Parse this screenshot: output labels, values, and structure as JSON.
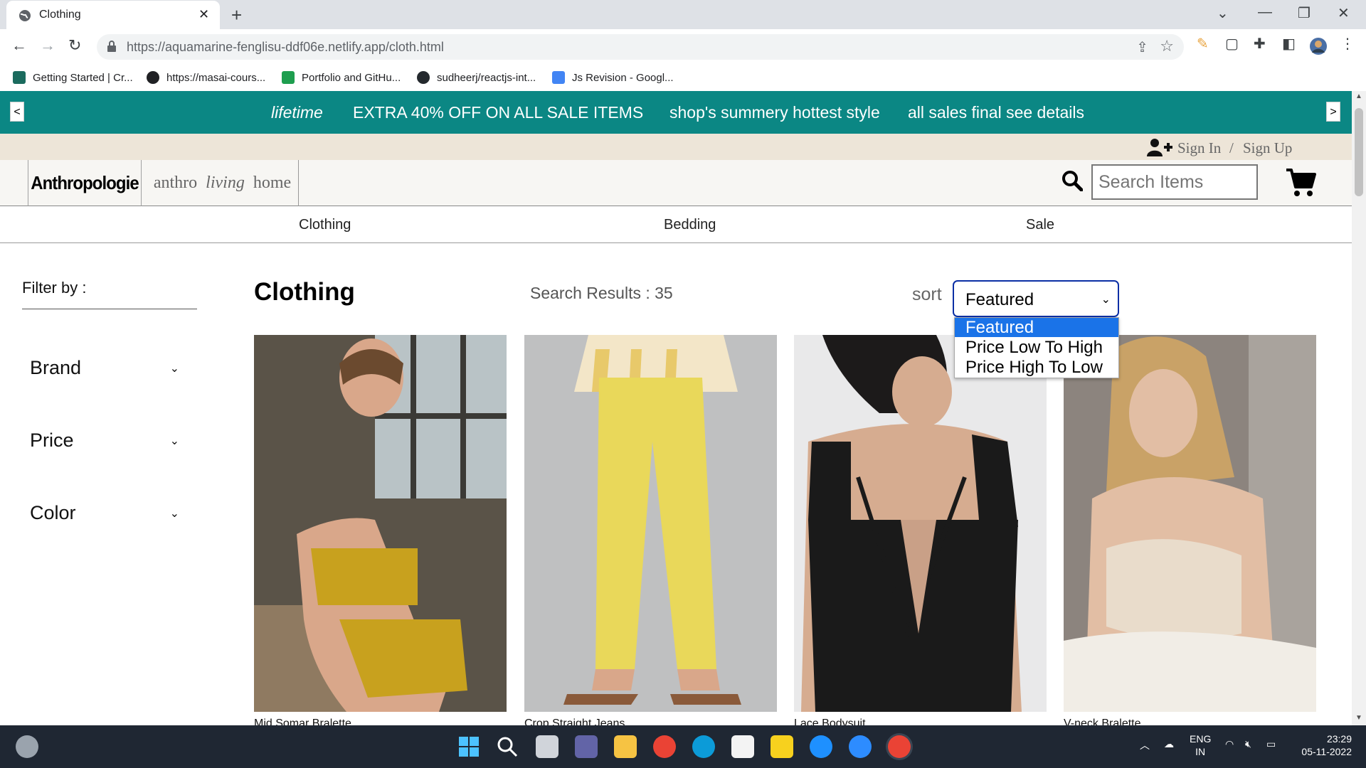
{
  "browser": {
    "tab_title": "Clothing",
    "url": "https://aquamarine-fenglisu-ddf06e.netlify.app/cloth.html",
    "bookmarks": [
      "Getting Started | Cr...",
      "https://masai-cours...",
      "Portfolio and GitHu...",
      "sudheerj/reactjs-int...",
      "Js Revision - Googl..."
    ]
  },
  "promo": {
    "prev": "<",
    "next": ">",
    "items": [
      "lifetime",
      "EXTRA 40% OFF ON ALL SALE ITEMS",
      "shop's summery hottest style",
      "all sales final see details"
    ]
  },
  "account": {
    "sign_in": "Sign In",
    "separator": "/",
    "sign_up": "Sign Up"
  },
  "header": {
    "logo": "Anthropologie",
    "logo2_a": "anthro",
    "logo2_b": "living",
    "logo2_c": "home",
    "search_placeholder": "Search Items"
  },
  "nav": [
    "Clothing",
    "Bedding",
    "Sale"
  ],
  "filters": {
    "title": "Filter by :",
    "facets": [
      "Brand",
      "Price",
      "Color"
    ]
  },
  "listing": {
    "heading": "Clothing",
    "results": "Search Results : 35",
    "sort_label": "sort",
    "sort_value": "Featured",
    "sort_options": [
      "Featured",
      "Price Low To High",
      "Price High To Low"
    ]
  },
  "products": [
    {
      "name": "Mid Somar Bralette"
    },
    {
      "name": "Crop Straight Jeans"
    },
    {
      "name": "Lace Bodysuit"
    },
    {
      "name": "V-neck Bralette"
    }
  ],
  "taskbar": {
    "lang1": "ENG",
    "lang2": "IN",
    "time": "23:29",
    "date": "05-11-2022"
  },
  "colors": {
    "promo_bg": "#0b8784",
    "account_bg": "#ede5d8",
    "header_bg": "#f7f6f3",
    "select_border": "#0b2fa5",
    "option_highlight": "#1a73e8"
  }
}
